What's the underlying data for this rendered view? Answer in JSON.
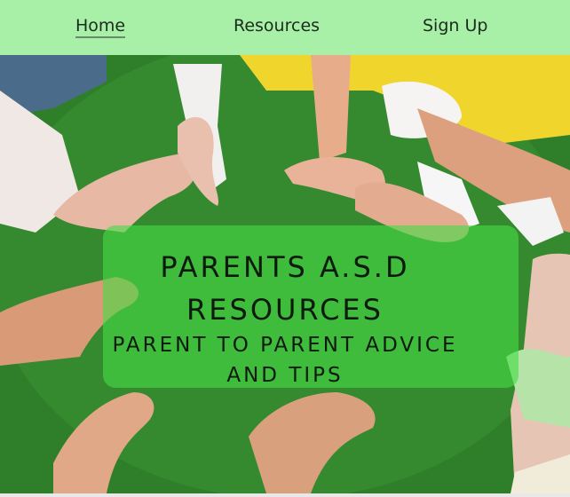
{
  "nav": {
    "items": [
      {
        "label": "Home",
        "active": true
      },
      {
        "label": "Resources",
        "active": false
      },
      {
        "label": "Sign Up",
        "active": false
      }
    ]
  },
  "hero": {
    "image": "children-hands-on-grass-photo",
    "heading_line1": "PARENTS A.S.D",
    "heading_line2": "RESOURCES",
    "subheading_line1": "PARENT TO PARENT ADVICE",
    "subheading_line2": "AND TIPS"
  },
  "colors": {
    "nav_bg": "#a8f0a8",
    "panel_bg": "rgba(70,220,70,0.62)",
    "text": "#0d1a0d"
  }
}
